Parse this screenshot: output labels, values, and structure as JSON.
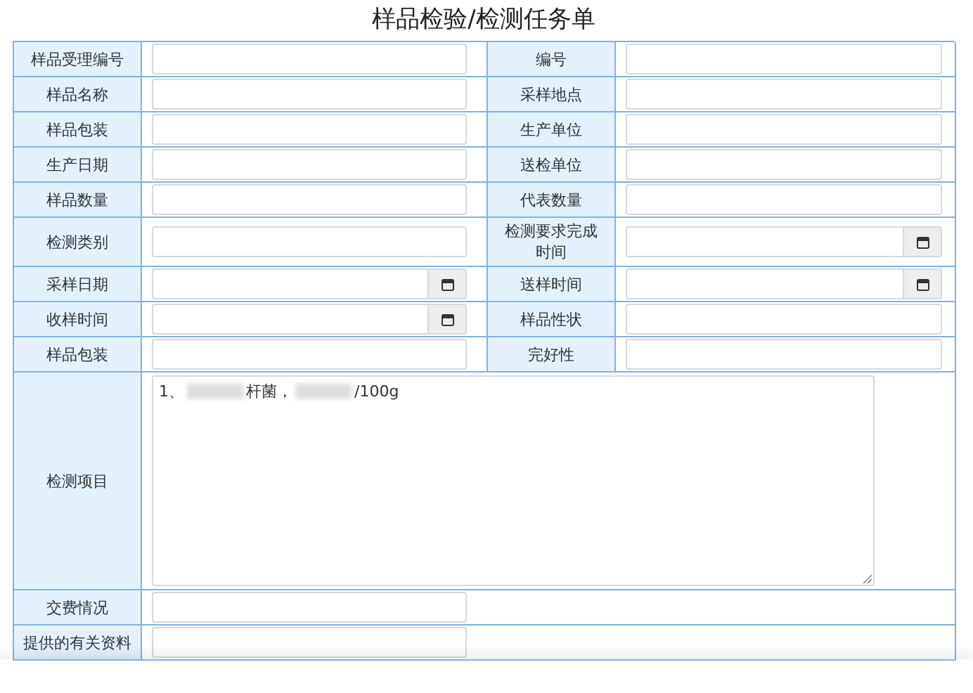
{
  "title": "样品检验/检测任务单",
  "rows": [
    {
      "cells": [
        {
          "label": "样品受理编号",
          "field": {
            "kind": "text"
          }
        },
        {
          "label": "编号",
          "field": {
            "kind": "text"
          }
        }
      ]
    },
    {
      "cells": [
        {
          "label": "样品名称",
          "field": {
            "kind": "text"
          }
        },
        {
          "label": "采样地点",
          "field": {
            "kind": "text"
          }
        }
      ]
    },
    {
      "cells": [
        {
          "label": "样品包装",
          "field": {
            "kind": "text"
          }
        },
        {
          "label": "生产单位",
          "field": {
            "kind": "text"
          }
        }
      ]
    },
    {
      "cells": [
        {
          "label": "生产日期",
          "field": {
            "kind": "text"
          }
        },
        {
          "label": "送检单位",
          "field": {
            "kind": "text"
          }
        }
      ]
    },
    {
      "cells": [
        {
          "label": "样品数量",
          "field": {
            "kind": "text"
          }
        },
        {
          "label": "代表数量",
          "field": {
            "kind": "text"
          }
        }
      ]
    },
    {
      "cells": [
        {
          "label": "检测类别",
          "field": {
            "kind": "text"
          }
        },
        {
          "label": "检测要求完成时间",
          "field": {
            "kind": "date"
          }
        }
      ]
    },
    {
      "cells": [
        {
          "label": "采样日期",
          "field": {
            "kind": "date"
          }
        },
        {
          "label": "送样时间",
          "field": {
            "kind": "date"
          }
        }
      ]
    },
    {
      "cells": [
        {
          "label": "收样时间",
          "field": {
            "kind": "date"
          }
        },
        {
          "label": "样品性状",
          "field": {
            "kind": "text"
          }
        }
      ]
    },
    {
      "cells": [
        {
          "label": "样品包装",
          "field": {
            "kind": "text"
          }
        },
        {
          "label": "完好性",
          "field": {
            "kind": "text"
          }
        }
      ]
    }
  ],
  "items": {
    "label": "检测项目",
    "parts": [
      {
        "kind": "text",
        "text": "1、"
      },
      {
        "kind": "redacted"
      },
      {
        "kind": "text",
        "text": "杆菌，"
      },
      {
        "kind": "redacted"
      },
      {
        "kind": "text",
        "text": "/100g"
      }
    ]
  },
  "extra_rows": [
    {
      "label": "交费情况"
    },
    {
      "label": "提供的有关资料"
    }
  ]
}
